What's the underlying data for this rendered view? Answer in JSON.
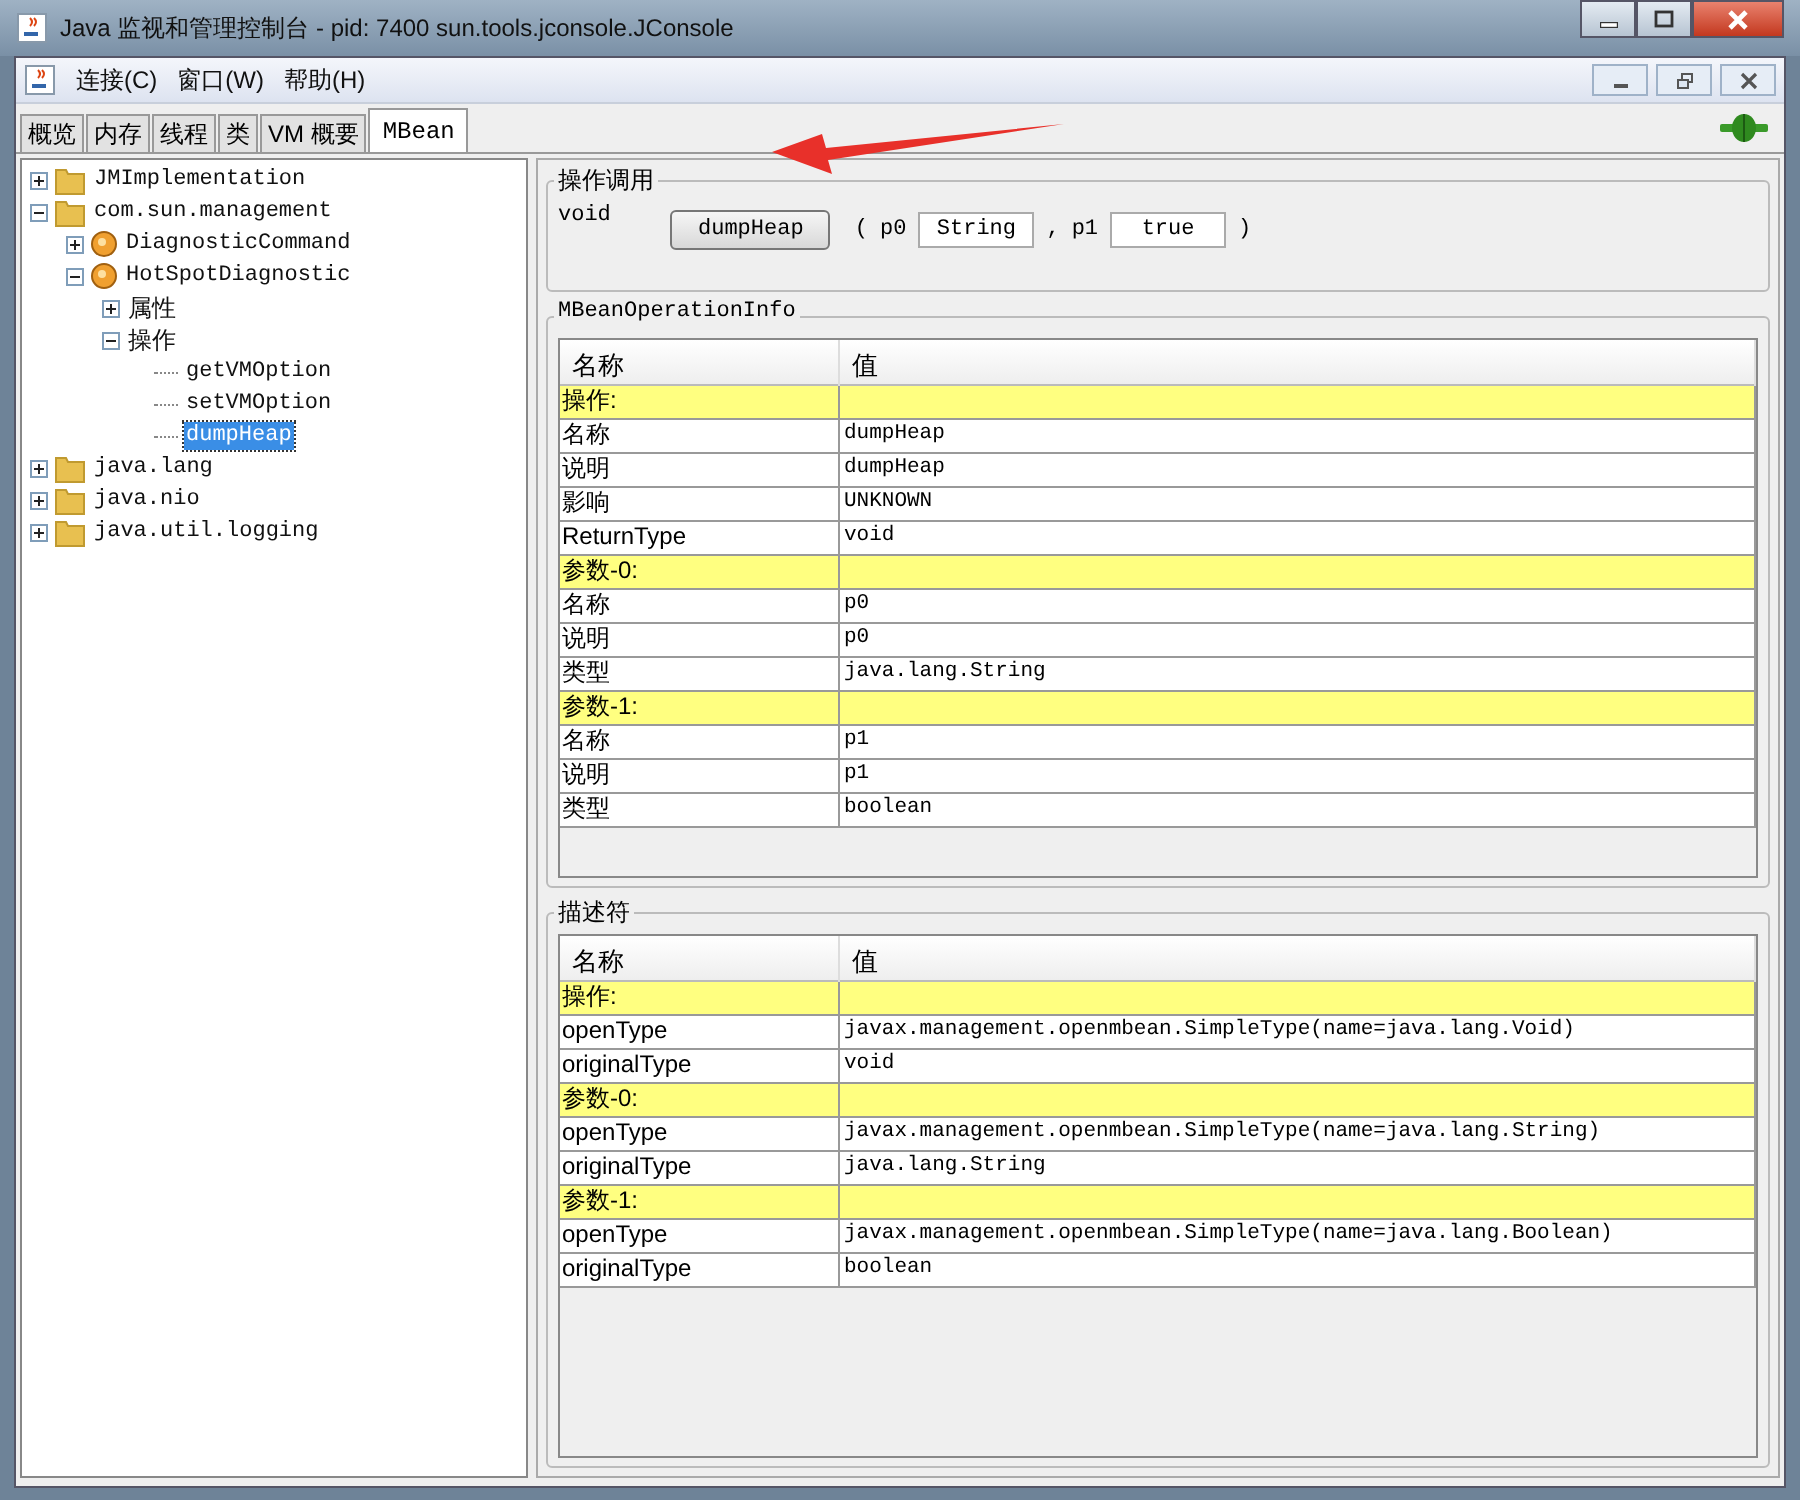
{
  "window": {
    "title": "Java 监视和管理控制台 - pid: 7400 sun.tools.jconsole.JConsole"
  },
  "menu": [
    {
      "label": "连接(C)"
    },
    {
      "label": "窗口(W)"
    },
    {
      "label": "帮助(H)"
    }
  ],
  "tabs": [
    {
      "label": "概览",
      "selected": false
    },
    {
      "label": "内存",
      "selected": false
    },
    {
      "label": "线程",
      "selected": false
    },
    {
      "label": "类",
      "selected": false
    },
    {
      "label": "VM 概要",
      "selected": false
    },
    {
      "label": "MBean",
      "selected": true
    }
  ],
  "tree": [
    {
      "label": "JMImplementation",
      "kind": "folder",
      "expanded": false,
      "selected": false
    },
    {
      "label": "com.sun.management",
      "kind": "folder",
      "expanded": true,
      "selected": false,
      "children": [
        {
          "label": "DiagnosticCommand",
          "kind": "bean",
          "expanded": false,
          "selected": false
        },
        {
          "label": "HotSpotDiagnostic",
          "kind": "bean",
          "expanded": true,
          "selected": false,
          "children": [
            {
              "label": "属性",
              "kind": "group",
              "expanded": false,
              "selected": false
            },
            {
              "label": "操作",
              "kind": "group",
              "expanded": true,
              "selected": false,
              "children": [
                {
                  "label": "getVMOption",
                  "kind": "leaf",
                  "selected": false
                },
                {
                  "label": "setVMOption",
                  "kind": "leaf",
                  "selected": false
                },
                {
                  "label": "dumpHeap",
                  "kind": "leaf",
                  "selected": true
                }
              ]
            }
          ]
        }
      ]
    },
    {
      "label": "java.lang",
      "kind": "folder",
      "expanded": false,
      "selected": false
    },
    {
      "label": "java.nio",
      "kind": "folder",
      "expanded": false,
      "selected": false
    },
    {
      "label": "java.util.logging",
      "kind": "folder",
      "expanded": false,
      "selected": false
    }
  ],
  "invoke": {
    "title": "操作调用",
    "return_type": "void",
    "button": "dumpHeap",
    "open": "(",
    "separator": ",",
    "close": ")",
    "params": [
      {
        "name": "p0",
        "value": "String"
      },
      {
        "name": "p1",
        "value": "true"
      }
    ]
  },
  "info_table": {
    "title": "MBeanOperationInfo",
    "columns": [
      "名称",
      "值"
    ],
    "rows": [
      {
        "kind": "section",
        "name": "操作:"
      },
      {
        "kind": "row",
        "name": "名称",
        "value": "dumpHeap"
      },
      {
        "kind": "row",
        "name": "说明",
        "value": "dumpHeap"
      },
      {
        "kind": "row",
        "name": "影响",
        "value": "UNKNOWN"
      },
      {
        "kind": "row",
        "name": "ReturnType",
        "value": "void"
      },
      {
        "kind": "section",
        "name": "参数-0:"
      },
      {
        "kind": "row",
        "name": "名称",
        "value": "p0"
      },
      {
        "kind": "row",
        "name": "说明",
        "value": "p0"
      },
      {
        "kind": "row",
        "name": "类型",
        "value": "java.lang.String"
      },
      {
        "kind": "section",
        "name": "参数-1:"
      },
      {
        "kind": "row",
        "name": "名称",
        "value": "p1"
      },
      {
        "kind": "row",
        "name": "说明",
        "value": "p1"
      },
      {
        "kind": "row",
        "name": "类型",
        "value": "boolean"
      }
    ]
  },
  "descriptor_table": {
    "title": "描述符",
    "columns": [
      "名称",
      "值"
    ],
    "rows": [
      {
        "kind": "section",
        "name": "操作:"
      },
      {
        "kind": "row",
        "name": "openType",
        "value": "javax.management.openmbean.SimpleType(name=java.lang.Void)"
      },
      {
        "kind": "row",
        "name": "originalType",
        "value": "void"
      },
      {
        "kind": "section",
        "name": "参数-0:"
      },
      {
        "kind": "row",
        "name": "openType",
        "value": "javax.management.openmbean.SimpleType(name=java.lang.String)"
      },
      {
        "kind": "row",
        "name": "originalType",
        "value": "java.lang.String"
      },
      {
        "kind": "section",
        "name": "参数-1:"
      },
      {
        "kind": "row",
        "name": "openType",
        "value": "javax.management.openmbean.SimpleType(name=java.lang.Boolean)"
      },
      {
        "kind": "row",
        "name": "originalType",
        "value": "boolean"
      }
    ]
  }
}
